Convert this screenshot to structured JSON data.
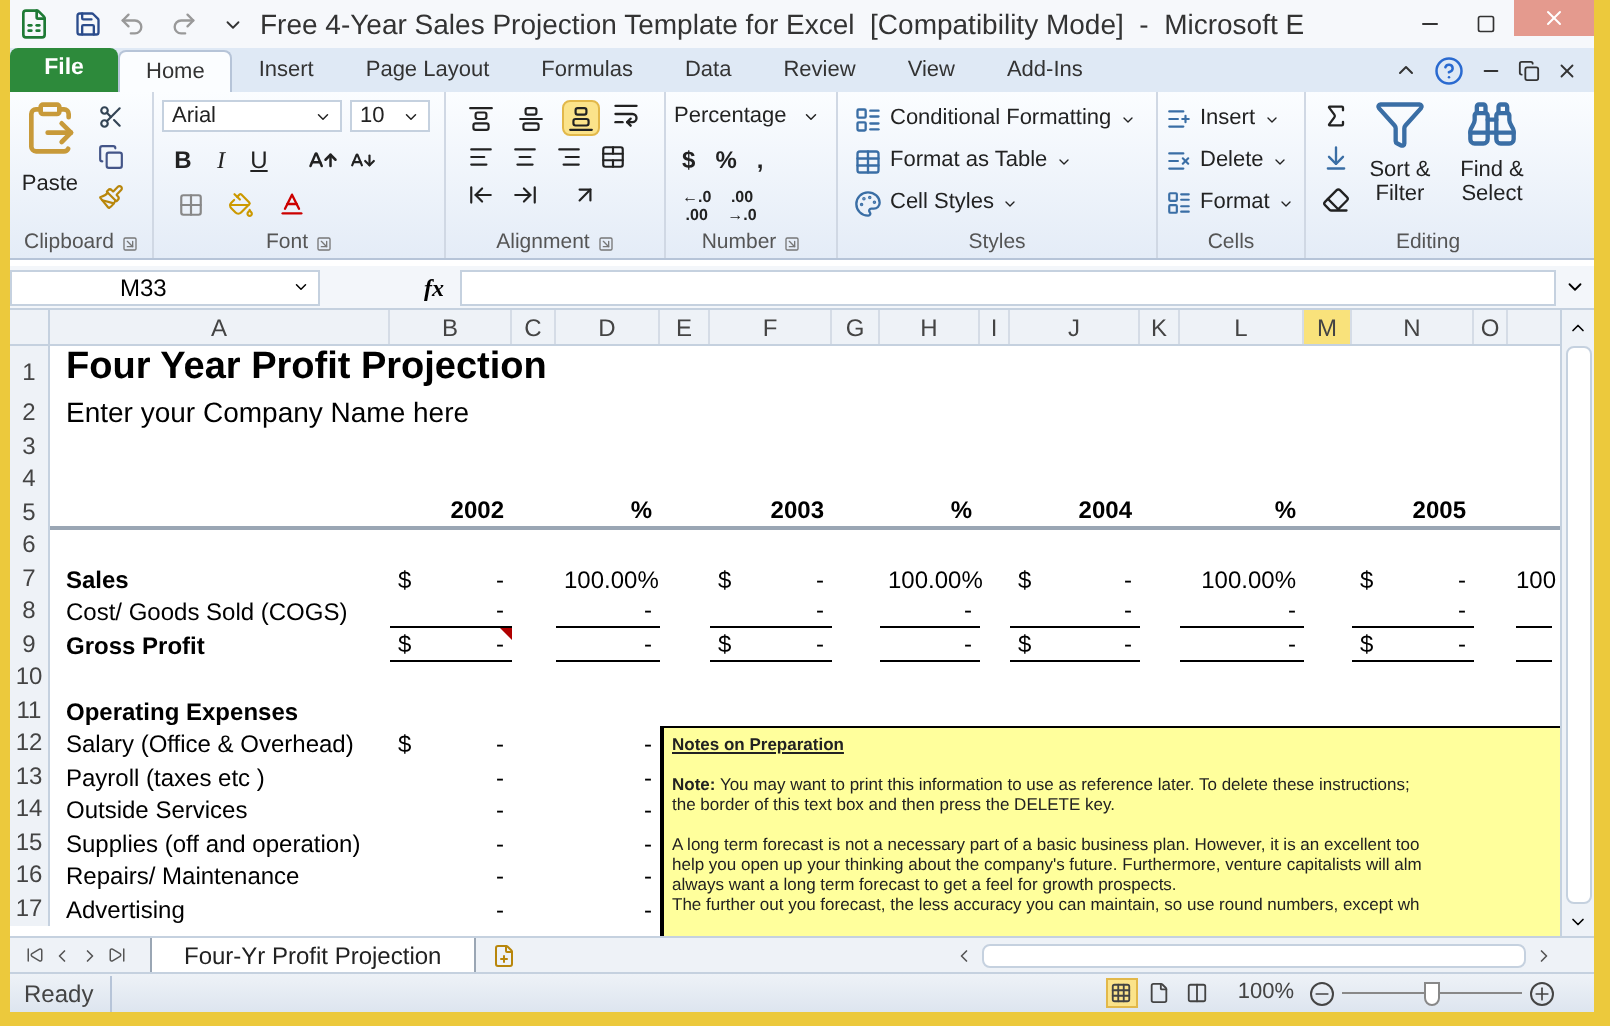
{
  "window": {
    "title": "Free 4-Year Sales Projection Template for Excel  [Compatibility Mode]  -  Microsoft E"
  },
  "tabs": [
    {
      "label": "File",
      "kind": "file",
      "selected": false
    },
    {
      "label": "Home",
      "kind": "tab",
      "selected": true
    },
    {
      "label": "Insert",
      "kind": "tab",
      "selected": false
    },
    {
      "label": "Page Layout",
      "kind": "tab",
      "selected": false
    },
    {
      "label": "Formulas",
      "kind": "tab",
      "selected": false
    },
    {
      "label": "Data",
      "kind": "tab",
      "selected": false
    },
    {
      "label": "Review",
      "kind": "tab",
      "selected": false
    },
    {
      "label": "View",
      "kind": "tab",
      "selected": false
    },
    {
      "label": "Add-Ins",
      "kind": "tab",
      "selected": false
    }
  ],
  "ribbon": {
    "clipboard": {
      "label": "Clipboard",
      "paste": "Paste"
    },
    "font": {
      "label": "Font",
      "font_name": "Arial",
      "font_size": "10",
      "styles": [
        "B",
        "I",
        "U"
      ]
    },
    "alignment": {
      "label": "Alignment",
      "vertical": [
        {
          "selected": false
        },
        {
          "selected": false
        },
        {
          "selected": true
        }
      ]
    },
    "number": {
      "label": "Number",
      "format": "Percentage",
      "symbols": [
        "$",
        "%",
        ","
      ],
      "decimals": [
        [
          "←.0",
          ".00"
        ],
        [
          ".00",
          "→.0"
        ]
      ]
    },
    "styles": {
      "label": "Styles",
      "commands": [
        "Conditional Formatting",
        "Format as Table",
        "Cell Styles"
      ]
    },
    "cells": {
      "label": "Cells",
      "commands": [
        "Insert",
        "Delete",
        "Format"
      ]
    },
    "editing": {
      "label": "Editing",
      "commands": [
        "Sort & Filter",
        "Find & Select"
      ]
    }
  },
  "formula_bar": {
    "name_box": "M33",
    "function_label": "fx"
  },
  "sheet": {
    "columns": [
      {
        "letter": "A",
        "selected": false
      },
      {
        "letter": "B",
        "selected": false
      },
      {
        "letter": "C",
        "selected": false
      },
      {
        "letter": "D",
        "selected": false
      },
      {
        "letter": "E",
        "selected": false
      },
      {
        "letter": "F",
        "selected": false
      },
      {
        "letter": "G",
        "selected": false
      },
      {
        "letter": "H",
        "selected": false
      },
      {
        "letter": "I",
        "selected": false
      },
      {
        "letter": "J",
        "selected": false
      },
      {
        "letter": "K",
        "selected": false
      },
      {
        "letter": "L",
        "selected": false
      },
      {
        "letter": "M",
        "selected": true
      },
      {
        "letter": "N",
        "selected": false
      },
      {
        "letter": "O",
        "selected": false
      }
    ],
    "rows": [
      {
        "number": "1",
        "kind": "title",
        "cells": [
          {
            "text": "Four Year Profit Projection"
          }
        ]
      },
      {
        "number": "2",
        "kind": "subtitle",
        "cells": [
          {
            "text": "Enter your Company Name here"
          }
        ]
      },
      {
        "number": "3"
      },
      {
        "number": "4"
      },
      {
        "number": "5",
        "kind": "header",
        "pane_split": true,
        "cells": [
          {
            "text": ""
          },
          {
            "text": "2002"
          },
          {
            "text": ""
          },
          {
            "text": "%"
          },
          {
            "text": ""
          },
          {
            "text": "2003"
          },
          {
            "text": ""
          },
          {
            "text": "%"
          },
          {
            "text": ""
          },
          {
            "text": "2004"
          },
          {
            "text": ""
          },
          {
            "text": "%"
          },
          {
            "text": ""
          },
          {
            "text": "2005"
          }
        ]
      },
      {
        "number": "6"
      },
      {
        "number": "7",
        "kind": "bold",
        "cells": [
          {
            "text": "Sales"
          },
          {
            "prefix": "$",
            "text": "-"
          },
          {
            "text": ""
          },
          {
            "text": "100.00%"
          },
          {
            "text": ""
          },
          {
            "prefix": "$",
            "text": "-"
          },
          {
            "text": ""
          },
          {
            "text": "100.00%"
          },
          {
            "text": ""
          },
          {
            "prefix": "$",
            "text": "-"
          },
          {
            "text": ""
          },
          {
            "text": "100.00%"
          },
          {
            "text": ""
          },
          {
            "prefix": "$",
            "text": "-"
          },
          {
            "text": ""
          },
          {
            "text": "100"
          }
        ]
      },
      {
        "number": "8",
        "kind": "normal",
        "cells": [
          {
            "text": "Cost/ Goods Sold (COGS)"
          },
          {
            "text": "-",
            "underlined": true
          },
          {
            "text": ""
          },
          {
            "text": "-",
            "underlined": true
          },
          {
            "text": ""
          },
          {
            "text": "-",
            "underlined": true
          },
          {
            "text": ""
          },
          {
            "text": "-",
            "underlined": true
          },
          {
            "text": ""
          },
          {
            "text": "-",
            "underlined": true
          },
          {
            "text": ""
          },
          {
            "text": "-",
            "underlined": true
          },
          {
            "text": ""
          },
          {
            "text": "-",
            "underlined": true
          },
          {
            "text": ""
          },
          {
            "text": "",
            "underlined": true
          }
        ]
      },
      {
        "number": "9",
        "kind": "bold",
        "cells": [
          {
            "text": "Gross Profit"
          },
          {
            "prefix": "$",
            "text": "-",
            "underlined": true,
            "comment": true
          },
          {
            "text": ""
          },
          {
            "text": "-",
            "underlined": true
          },
          {
            "text": ""
          },
          {
            "prefix": "$",
            "text": "-",
            "underlined": true
          },
          {
            "text": ""
          },
          {
            "text": "-",
            "underlined": true
          },
          {
            "text": ""
          },
          {
            "prefix": "$",
            "text": "-",
            "underlined": true
          },
          {
            "text": ""
          },
          {
            "text": "-",
            "underlined": true
          },
          {
            "text": ""
          },
          {
            "prefix": "$",
            "text": "-",
            "underlined": true
          },
          {
            "text": ""
          },
          {
            "text": "",
            "underlined": true
          }
        ]
      },
      {
        "number": "10"
      },
      {
        "number": "11",
        "kind": "bold",
        "cells": [
          {
            "text": "Operating Expenses"
          }
        ]
      },
      {
        "number": "12",
        "kind": "normal",
        "cells": [
          {
            "text": "Salary (Office & Overhead)"
          },
          {
            "prefix": "$",
            "text": "-"
          },
          {
            "text": ""
          },
          {
            "text": "-"
          }
        ]
      },
      {
        "number": "13",
        "kind": "normal",
        "cells": [
          {
            "text": "Payroll (taxes etc )"
          },
          {
            "text": "-"
          },
          {
            "text": ""
          },
          {
            "text": "-"
          }
        ]
      },
      {
        "number": "14",
        "kind": "normal",
        "cells": [
          {
            "text": "Outside Services"
          },
          {
            "text": "-"
          },
          {
            "text": ""
          },
          {
            "text": "-"
          }
        ]
      },
      {
        "number": "15",
        "kind": "normal",
        "cells": [
          {
            "text": "Supplies (off and operation)"
          },
          {
            "text": "-"
          },
          {
            "text": ""
          },
          {
            "text": "-"
          }
        ]
      },
      {
        "number": "16",
        "kind": "normal",
        "cells": [
          {
            "text": "Repairs/ Maintenance"
          },
          {
            "text": "-"
          },
          {
            "text": ""
          },
          {
            "text": "-"
          }
        ]
      },
      {
        "number": "17",
        "kind": "normal",
        "cells": [
          {
            "text": "Advertising"
          },
          {
            "text": "-"
          },
          {
            "text": ""
          },
          {
            "text": "-"
          }
        ]
      }
    ],
    "notes": {
      "title": "Notes on Preparation",
      "paragraphs": [
        [
          "**Note:** You may want to print this information to use as reference later. To delete these instructions;",
          "the border of this text box and then press the DELETE  key."
        ],
        [
          "A long term forecast is not a necessary part of a basic business plan. However, it is an excellent too",
          "help you open up your thinking about the company's future. Furthermore, venture capitalists will alm",
          "always want a long term forecast to get a feel for growth prospects.",
          "The further out you forecast, the less accuracy you can maintain, so use round numbers, except wh"
        ]
      ]
    }
  },
  "sheet_tabs": [
    {
      "label": "Four-Yr Profit Projection",
      "selected": true
    }
  ],
  "status_bar": {
    "status": "Ready",
    "views": [
      {
        "selected": true
      },
      {
        "selected": false
      },
      {
        "selected": false
      }
    ],
    "zoom": "100%",
    "level": 0.5
  }
}
